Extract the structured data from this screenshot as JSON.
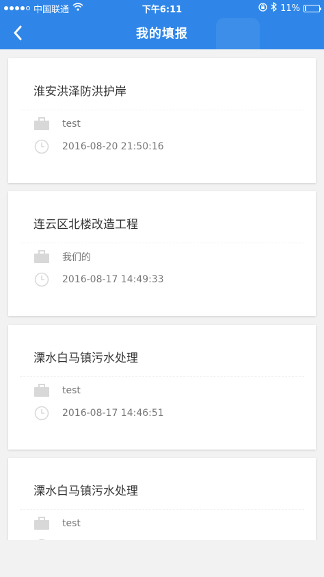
{
  "status_bar": {
    "carrier": "中国联通",
    "time": "下午6:11",
    "battery_percent": "11%",
    "battery_level": 0.11
  },
  "nav": {
    "title": "我的填报"
  },
  "items": [
    {
      "title": "淮安洪泽防洪护岸",
      "user": "test",
      "time": "2016-08-20 21:50:16"
    },
    {
      "title": "连云区北楼改造工程",
      "user": "我们的",
      "time": "2016-08-17 14:49:33"
    },
    {
      "title": "溧水白马镇污水处理",
      "user": "test",
      "time": "2016-08-17 14:46:51"
    },
    {
      "title": "溧水白马镇污水处理",
      "user": "test",
      "time": ""
    }
  ],
  "colors": {
    "nav_blue": "#2f86e8",
    "icon_gray": "#d8d8d8"
  }
}
